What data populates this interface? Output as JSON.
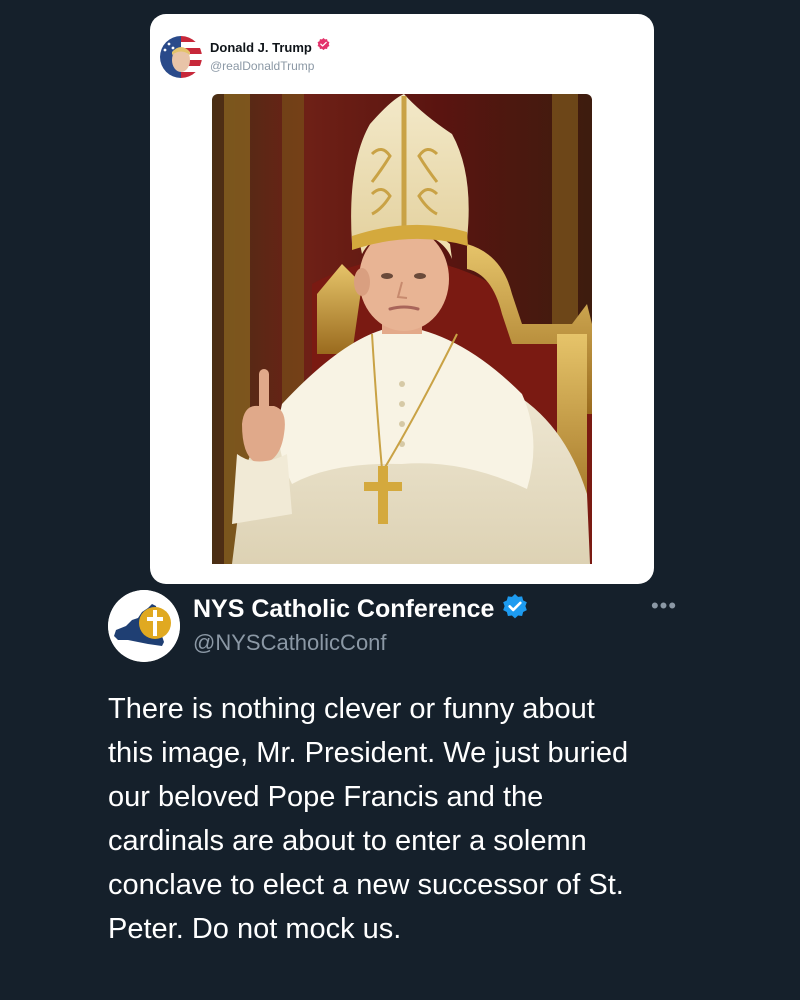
{
  "quoted_tweet": {
    "author_name": "Donald J. Trump",
    "author_handle": "@realDonaldTrump",
    "verified_icon": "verified-badge-icon",
    "media": "ai-generated-papal-portrait"
  },
  "main_tweet": {
    "author_name": "NYS Catholic Conference",
    "author_handle": "@NYSCatholicConf",
    "verified_icon": "verified-badge-icon",
    "more_label": "•••",
    "text_lines": [
      "There is nothing clever or funny about",
      "this image, Mr. President. We just buried",
      "our beloved Pope Francis and the",
      "cardinals are about to enter a solemn",
      "conclave to elect a new successor of St.",
      "Peter. Do not mock us."
    ]
  },
  "colors": {
    "background": "#15202b",
    "verified_blue": "#1d9bf0",
    "verified_pink": "#e3336b",
    "handle_gray": "#8b98a5",
    "text_white": "#ffffff"
  }
}
